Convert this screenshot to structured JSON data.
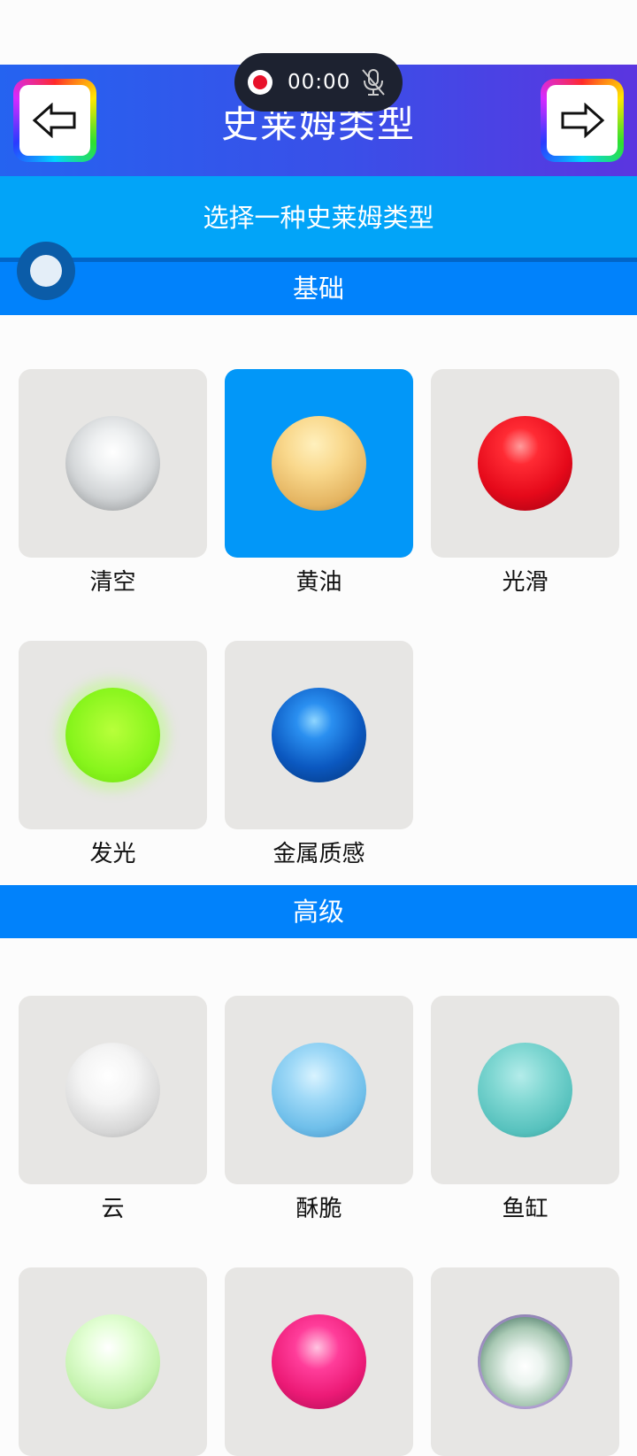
{
  "header": {
    "title": "史莱姆类型"
  },
  "recorder": {
    "time": "00:00"
  },
  "subtitle": "选择一种史莱姆类型",
  "sections": {
    "basic": {
      "title": "基础",
      "items": [
        {
          "label": "清空",
          "ball": "clear-ball",
          "selected": false
        },
        {
          "label": "黄油",
          "ball": "butter-ball",
          "selected": true
        },
        {
          "label": "光滑",
          "ball": "smooth-ball",
          "selected": false
        },
        {
          "label": "发光",
          "ball": "glow-ball",
          "selected": false
        },
        {
          "label": "金属质感",
          "ball": "metallic-ball",
          "selected": false
        }
      ]
    },
    "advanced": {
      "title": "高级",
      "items": [
        {
          "label": "云",
          "ball": "cloud-ball",
          "selected": false
        },
        {
          "label": "酥脆",
          "ball": "crispy-ball",
          "selected": false
        },
        {
          "label": "鱼缸",
          "ball": "fishbowl-ball",
          "selected": false
        },
        {
          "label": "",
          "ball": "mint-ball",
          "selected": false
        },
        {
          "label": "",
          "ball": "pink-ball",
          "selected": false
        },
        {
          "label": "",
          "ball": "bubble-ball",
          "selected": false
        }
      ]
    }
  },
  "colors": {
    "header_gradient_start": "#2563f0",
    "header_gradient_end": "#5b35e0",
    "subtitle_bg": "#02a4f8",
    "section_bg": "#0182fb",
    "selected_tile": "#0297f8",
    "tile_bg": "#e7e6e4"
  },
  "icons": {
    "back": "arrow-left-icon",
    "forward": "arrow-right-icon",
    "record": "record-icon",
    "mic": "mic-off-icon"
  }
}
